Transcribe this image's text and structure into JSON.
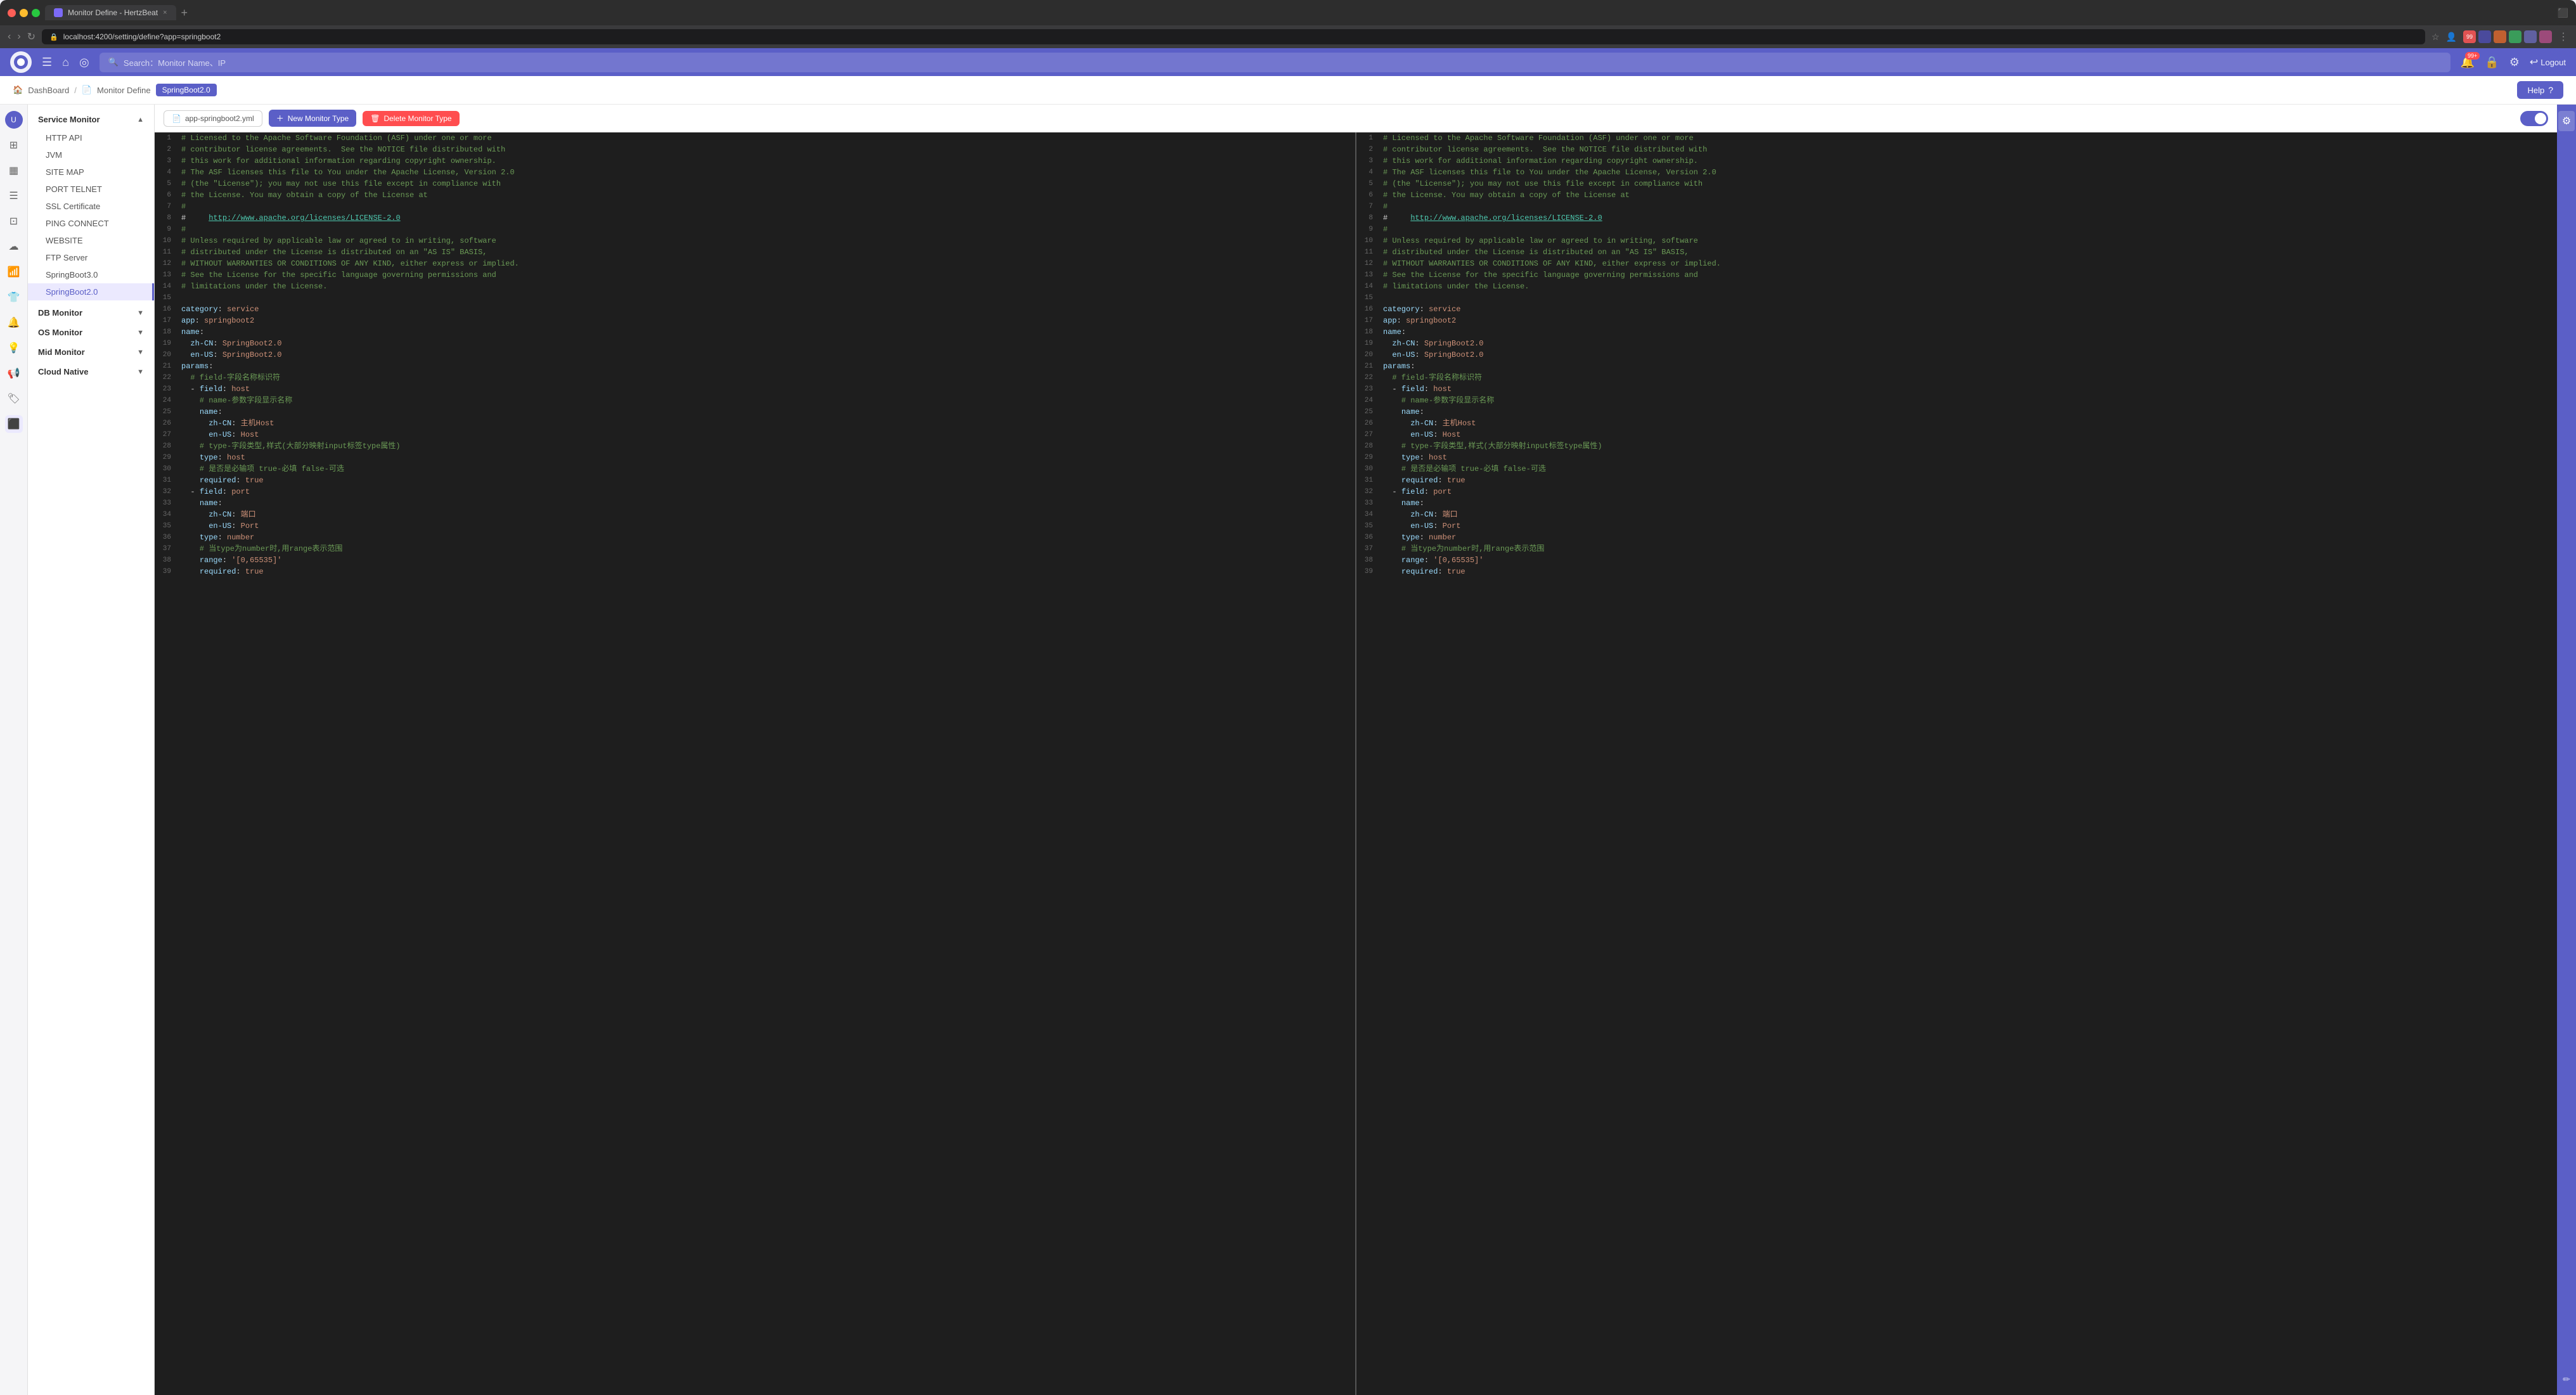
{
  "browser": {
    "tab_title": "Monitor Define - HertzBeat",
    "tab_close": "×",
    "tab_add": "+",
    "url": "localhost:4200/setting/define?app=springboot2",
    "nav_back": "‹",
    "nav_forward": "›",
    "nav_reload": "↻",
    "extensions": [
      "99+"
    ]
  },
  "header": {
    "search_placeholder": "Search：Monitor Name、IP",
    "notification_count": "99+",
    "logout_label": "Logout"
  },
  "breadcrumb": {
    "home": "DashBoard",
    "separator": "/",
    "page": "Monitor Define",
    "current_tab": "SpringBoot2.0",
    "help_label": "Help"
  },
  "sidebar": {
    "groups": [
      {
        "label": "Service Monitor",
        "expanded": true,
        "items": [
          "HTTP API",
          "JVM",
          "SITE MAP",
          "PORT TELNET",
          "SSL Certificate",
          "PING CONNECT",
          "WEBSITE",
          "FTP Server",
          "SpringBoot3.0",
          "SpringBoot2.0"
        ]
      },
      {
        "label": "DB Monitor",
        "expanded": false,
        "items": []
      },
      {
        "label": "OS Monitor",
        "expanded": false,
        "items": []
      },
      {
        "label": "Mid Monitor",
        "expanded": false,
        "items": []
      },
      {
        "label": "Cloud Native",
        "expanded": false,
        "items": []
      }
    ]
  },
  "toolbar": {
    "file_btn": "app-springboot2.yml",
    "new_monitor_btn": "New Monitor Type",
    "delete_monitor_btn": "Delete Monitor Type",
    "toggle_state": true
  },
  "code_lines": [
    {
      "num": 1,
      "type": "comment",
      "text": "# Licensed to the Apache Software Foundation (ASF) under one or more"
    },
    {
      "num": 2,
      "type": "comment",
      "text": "# contributor license agreements.  See the NOTICE file distributed with"
    },
    {
      "num": 3,
      "type": "comment",
      "text": "# this work for additional information regarding copyright ownership."
    },
    {
      "num": 4,
      "type": "comment",
      "text": "# The ASF licenses this file to You under the Apache License, Version 2.0"
    },
    {
      "num": 5,
      "type": "comment",
      "text": "# (the \"License\"); you may not use this file except in compliance with"
    },
    {
      "num": 6,
      "type": "comment",
      "text": "# the License. You may obtain a copy of the License at"
    },
    {
      "num": 7,
      "type": "comment",
      "text": "#"
    },
    {
      "num": 8,
      "type": "link",
      "text": "#     http://www.apache.org/licenses/LICENSE-2.0"
    },
    {
      "num": 9,
      "type": "comment",
      "text": "#"
    },
    {
      "num": 10,
      "type": "comment",
      "text": "# Unless required by applicable law or agreed to in writing, software"
    },
    {
      "num": 11,
      "type": "comment",
      "text": "# distributed under the License is distributed on an \"AS IS\" BASIS,"
    },
    {
      "num": 12,
      "type": "comment",
      "text": "# WITHOUT WARRANTIES OR CONDITIONS OF ANY KIND, either express or implied."
    },
    {
      "num": 13,
      "type": "comment",
      "text": "# See the License for the specific language governing permissions and"
    },
    {
      "num": 14,
      "type": "comment",
      "text": "# limitations under the License."
    },
    {
      "num": 15,
      "type": "empty",
      "text": ""
    },
    {
      "num": 16,
      "type": "keyval",
      "key": "category",
      "val": "service"
    },
    {
      "num": 17,
      "type": "keyval",
      "key": "app",
      "val": "springboot2"
    },
    {
      "num": 18,
      "type": "key",
      "text": "name:"
    },
    {
      "num": 19,
      "type": "indent",
      "text": "  zh-CN: SpringBoot2.0"
    },
    {
      "num": 20,
      "type": "indent",
      "text": "  en-US: SpringBoot2.0"
    },
    {
      "num": 21,
      "type": "key",
      "text": "params:"
    },
    {
      "num": 22,
      "type": "comment-indent",
      "text": "  # field-字段名称标识符"
    },
    {
      "num": 23,
      "type": "list",
      "text": "  - field: host"
    },
    {
      "num": 24,
      "type": "comment-indent",
      "text": "    # name-参数字段显示名称"
    },
    {
      "num": 25,
      "type": "indent",
      "text": "    name:"
    },
    {
      "num": 26,
      "type": "indent",
      "text": "      zh-CN: 主机Host"
    },
    {
      "num": 27,
      "type": "indent",
      "text": "      en-US: Host"
    },
    {
      "num": 28,
      "type": "comment-indent",
      "text": "    # type-字段类型,样式(大部分映射input标签type属性)"
    },
    {
      "num": 29,
      "type": "indent",
      "text": "    type: host"
    },
    {
      "num": 30,
      "type": "comment-indent",
      "text": "    # 是否是必输项 true-必填 false-可选"
    },
    {
      "num": 31,
      "type": "indent",
      "text": "    required: true"
    },
    {
      "num": 32,
      "type": "list",
      "text": "  - field: port"
    },
    {
      "num": 33,
      "type": "indent",
      "text": "    name:"
    },
    {
      "num": 34,
      "type": "indent",
      "text": "      zh-CN: 端口"
    },
    {
      "num": 35,
      "type": "indent",
      "text": "      en-US: Port"
    },
    {
      "num": 36,
      "type": "indent",
      "text": "    type: number"
    },
    {
      "num": 37,
      "type": "comment-indent",
      "text": "    # 当type为number时,用range表示范围"
    },
    {
      "num": 38,
      "type": "indent",
      "text": "    range: '[0,65535]'"
    },
    {
      "num": 39,
      "type": "indent",
      "text": "    required: true"
    }
  ]
}
